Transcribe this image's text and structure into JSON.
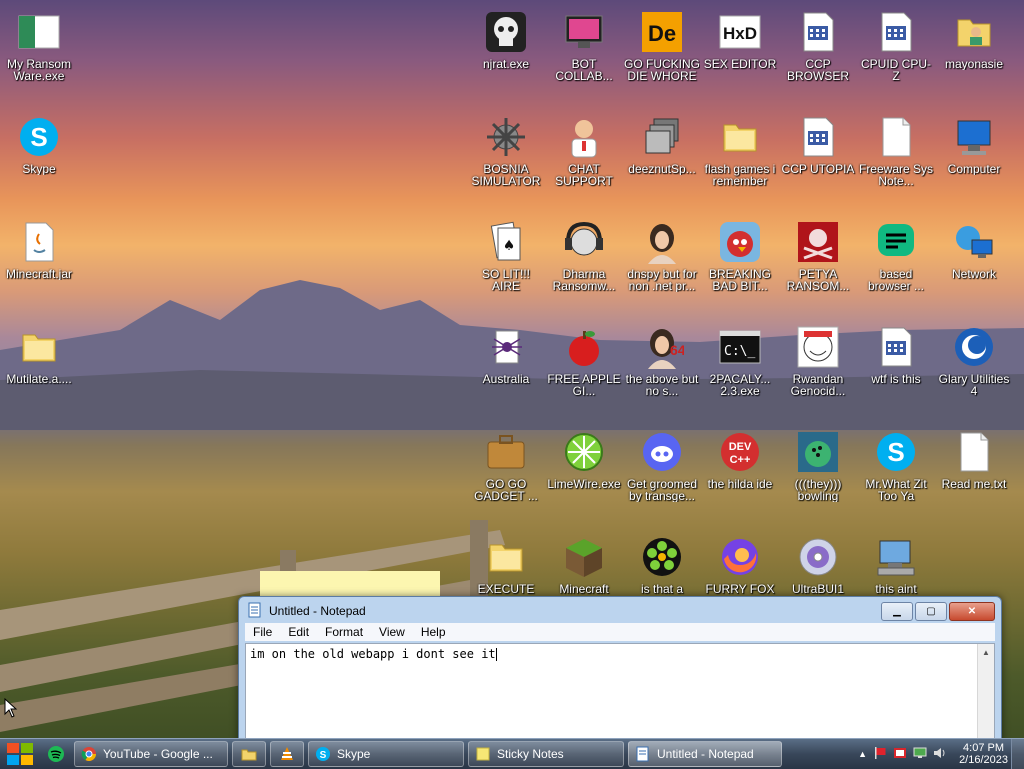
{
  "desktop_icons": {
    "c0": [
      {
        "label": "My Ransom Ware.exe",
        "icon": "green-white-flag-icon"
      },
      {
        "label": "Skype",
        "icon": "skype-icon"
      },
      {
        "label": "Minecraft.jar",
        "icon": "java-file-icon"
      },
      {
        "label": "Mutilate.a....",
        "icon": "folder-icon"
      }
    ],
    "grid": [
      {
        "label": "njrat.exe",
        "icon": "skull-icon"
      },
      {
        "label": "BOT COLLAB...",
        "icon": "monitor-pink-icon"
      },
      {
        "label": "GO FUCKING DIE WHORE",
        "icon": "de-logo-icon"
      },
      {
        "label": "SEX EDITOR",
        "icon": "hxd-icon"
      },
      {
        "label": "CCP BROWSER",
        "icon": "app-window-icon"
      },
      {
        "label": "CPUID CPU-Z",
        "icon": "app-window-icon"
      },
      {
        "label": "mayonasie",
        "icon": "user-folder-icon"
      },
      {
        "label": "BOSNIA SIMULATOR",
        "icon": "spiked-mine-icon"
      },
      {
        "label": "CHAT SUPPORT",
        "icon": "doctor-icon"
      },
      {
        "label": "deeznutSp...",
        "icon": "stacked-windows-icon"
      },
      {
        "label": "flash games i remember",
        "icon": "folder-icon"
      },
      {
        "label": "CCP UTOPIA",
        "icon": "app-window-icon"
      },
      {
        "label": "Freeware Sys Note...",
        "icon": "blank-file-icon"
      },
      {
        "label": "Computer",
        "icon": "computer-icon"
      },
      {
        "label": "SO LIT!!! AIRE",
        "icon": "cards-icon"
      },
      {
        "label": "Dharma Ransomw...",
        "icon": "skull-headphones-icon"
      },
      {
        "label": "dnspy but for non .net pr...",
        "icon": "portrait-icon"
      },
      {
        "label": "BREAKING BAD BIT...",
        "icon": "angry-bird-icon"
      },
      {
        "label": "PETYA RANSOM...",
        "icon": "red-skull-icon"
      },
      {
        "label": "based browser ...",
        "icon": "green-chat-icon"
      },
      {
        "label": "Network",
        "icon": "network-icon"
      },
      {
        "label": "Australia",
        "icon": "spider-icon"
      },
      {
        "label": "FREE APPLE GI...",
        "icon": "apple-icon"
      },
      {
        "label": "the above but no s...",
        "icon": "portrait-64-icon"
      },
      {
        "label": "2PACALY... 2.3.exe",
        "icon": "cmd-icon"
      },
      {
        "label": "Rwandan Genocid...",
        "icon": "meme-face-icon"
      },
      {
        "label": "wtf is this",
        "icon": "app-window-icon"
      },
      {
        "label": "Glary Utilities 4",
        "icon": "glary-icon"
      },
      {
        "label": "GO GO GADGET ...",
        "icon": "briefcase-icon"
      },
      {
        "label": "LimeWire.exe",
        "icon": "limewire-icon"
      },
      {
        "label": "Get groomed by transge...",
        "icon": "discord-icon"
      },
      {
        "label": "the hilda ide",
        "icon": "devcpp-icon"
      },
      {
        "label": "(((they))) bowling",
        "icon": "bowling-icon"
      },
      {
        "label": "Mr.What Zit Too Ya",
        "icon": "skype-icon"
      },
      {
        "label": "Read me.txt",
        "icon": "text-file-icon"
      },
      {
        "label": "EXECUTE",
        "icon": "folder-icon"
      },
      {
        "label": "Minecraft",
        "icon": "grass-block-icon"
      },
      {
        "label": "is that a",
        "icon": "icq-icon"
      },
      {
        "label": "FURRY FOX",
        "icon": "firefox-icon"
      },
      {
        "label": "UltraBUI1",
        "icon": "disc-icon"
      },
      {
        "label": "this aint",
        "icon": "computer-scan-icon"
      }
    ]
  },
  "notepad": {
    "title": "Untitled - Notepad",
    "menu": [
      "File",
      "Edit",
      "Format",
      "View",
      "Help"
    ],
    "content": "im on the old webapp i dont see it"
  },
  "taskbar": {
    "buttons": [
      {
        "label": "YouTube - Google ...",
        "icon": "chrome-icon"
      },
      {
        "label": "",
        "icon": "folder-icon"
      },
      {
        "label": "",
        "icon": "vlc-icon"
      },
      {
        "label": "Skype",
        "icon": "skype-icon"
      },
      {
        "label": "Sticky Notes",
        "icon": "sticky-notes-icon"
      },
      {
        "label": "Untitled - Notepad",
        "icon": "notepad-icon"
      }
    ],
    "clock_time": "4:07 PM",
    "clock_date": "2/16/2023"
  },
  "colors": {
    "taskbar": "#39475a",
    "notepad_frame": "#bcd4ee",
    "sticky": "#fcf6b0"
  }
}
